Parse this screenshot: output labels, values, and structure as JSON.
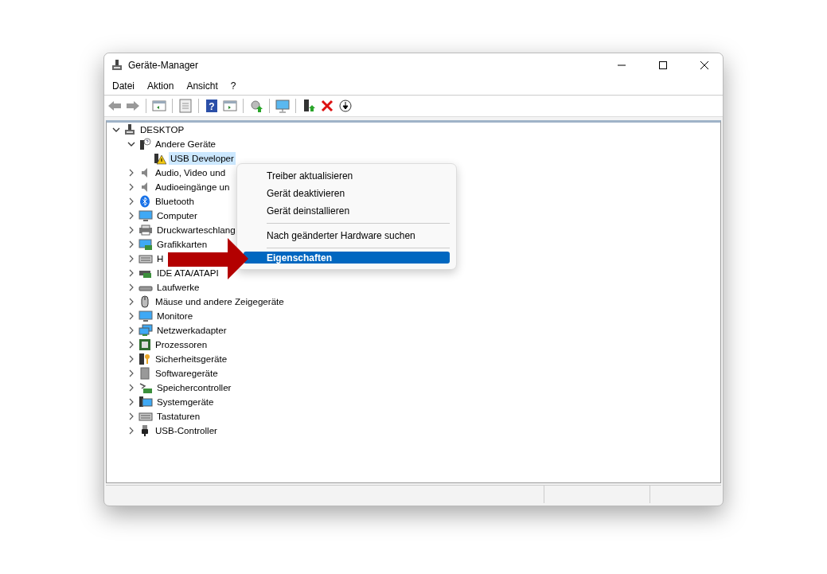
{
  "window": {
    "title": "Geräte-Manager"
  },
  "menu_bar": [
    "Datei",
    "Aktion",
    "Ansicht",
    "?"
  ],
  "toolbar": {
    "help_symbol": "?"
  },
  "tree": [
    {
      "label": "DESKTOP",
      "expanded": true,
      "selected": false,
      "children": [
        {
          "label": "Andere Geräte",
          "expanded": true,
          "selected": false,
          "children": [
            {
              "label": "USB Developer",
              "selected": true
            }
          ]
        },
        {
          "label": "Audio, Video und",
          "expanded": false,
          "selected": false
        },
        {
          "label": "Audioeingänge un",
          "expanded": false,
          "selected": false
        },
        {
          "label": "Bluetooth",
          "expanded": false,
          "selected": false
        },
        {
          "label": "Computer",
          "expanded": false,
          "selected": false
        },
        {
          "label": "Druckwarteschlang",
          "expanded": false,
          "selected": false
        },
        {
          "label": "Grafikkarten",
          "expanded": false,
          "selected": false
        },
        {
          "label": "H",
          "expanded": false,
          "selected": false
        },
        {
          "label": "IDE ATA/ATAPI",
          "expanded": false,
          "selected": false
        },
        {
          "label": "Laufwerke",
          "expanded": false,
          "selected": false
        },
        {
          "label": "Mäuse und andere Zeigegeräte",
          "expanded": false,
          "selected": false
        },
        {
          "label": "Monitore",
          "expanded": false,
          "selected": false
        },
        {
          "label": "Netzwerkadapter",
          "expanded": false,
          "selected": false
        },
        {
          "label": "Prozessoren",
          "expanded": false,
          "selected": false
        },
        {
          "label": "Sicherheitsgeräte",
          "expanded": false,
          "selected": false
        },
        {
          "label": "Softwaregeräte",
          "expanded": false,
          "selected": false
        },
        {
          "label": "Speichercontroller",
          "expanded": false,
          "selected": false
        },
        {
          "label": "Systemgeräte",
          "expanded": false,
          "selected": false
        },
        {
          "label": "Tastaturen",
          "expanded": false,
          "selected": false
        },
        {
          "label": "USB-Controller",
          "expanded": false,
          "selected": false
        }
      ]
    }
  ],
  "context_menu": [
    {
      "kind": "item",
      "label": "Treiber aktualisieren",
      "selected": false
    },
    {
      "kind": "item",
      "label": "Gerät deaktivieren",
      "selected": false
    },
    {
      "kind": "item",
      "label": "Gerät deinstallieren",
      "selected": false
    },
    {
      "kind": "separator"
    },
    {
      "kind": "item",
      "label": "Nach geänderter Hardware suchen",
      "selected": false
    },
    {
      "kind": "separator"
    },
    {
      "kind": "item",
      "label": "Eigenschaften",
      "selected": true
    }
  ]
}
